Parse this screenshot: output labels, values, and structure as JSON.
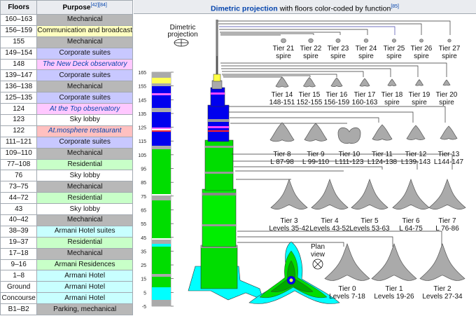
{
  "table": {
    "col_floors": "Floors",
    "col_purpose": "Purpose",
    "col_purpose_ref": "[42][84]",
    "rows": [
      {
        "floors": "160–163",
        "purpose": "Mechanical",
        "color": "#b8b8b8"
      },
      {
        "floors": "156–159",
        "purpose": "Communication and broadcast",
        "color": "#ffffc0"
      },
      {
        "floors": "155",
        "purpose": "Mechanical",
        "color": "#b8b8b8"
      },
      {
        "floors": "149–154",
        "purpose": "Corporate suites",
        "color": "#c8c8ff"
      },
      {
        "floors": "148",
        "purpose": "The New Deck observatory",
        "color": "#ffc8ff",
        "italic": true
      },
      {
        "floors": "139–147",
        "purpose": "Corporate suites",
        "color": "#c8c8ff"
      },
      {
        "floors": "136–138",
        "purpose": "Mechanical",
        "color": "#b8b8b8"
      },
      {
        "floors": "125–135",
        "purpose": "Corporate suites",
        "color": "#c8c8ff"
      },
      {
        "floors": "124",
        "purpose": "At the Top observatory",
        "color": "#ffc8ff",
        "italic": true
      },
      {
        "floors": "123",
        "purpose": "Sky lobby",
        "color": "#ffffff"
      },
      {
        "floors": "122",
        "purpose": "At.mosphere restaurant",
        "color": "#ffc0c0",
        "italic": true
      },
      {
        "floors": "111–121",
        "purpose": "Corporate suites",
        "color": "#c8c8ff"
      },
      {
        "floors": "109–110",
        "purpose": "Mechanical",
        "color": "#b8b8b8"
      },
      {
        "floors": "77–108",
        "purpose": "Residential",
        "color": "#c8ffc8"
      },
      {
        "floors": "76",
        "purpose": "Sky lobby",
        "color": "#ffffff"
      },
      {
        "floors": "73–75",
        "purpose": "Mechanical",
        "color": "#b8b8b8"
      },
      {
        "floors": "44–72",
        "purpose": "Residential",
        "color": "#c8ffc8"
      },
      {
        "floors": "43",
        "purpose": "Sky lobby",
        "color": "#ffffff"
      },
      {
        "floors": "40–42",
        "purpose": "Mechanical",
        "color": "#b8b8b8"
      },
      {
        "floors": "38–39",
        "purpose": "Armani Hotel suites",
        "color": "#c8ffff"
      },
      {
        "floors": "19–37",
        "purpose": "Residential",
        "color": "#c8ffc8"
      },
      {
        "floors": "17–18",
        "purpose": "Mechanical",
        "color": "#b8b8b8"
      },
      {
        "floors": "9–16",
        "purpose": "Armani Residences",
        "color": "#c8ffc8"
      },
      {
        "floors": "1–8",
        "purpose": "Armani Hotel",
        "color": "#c8ffff"
      },
      {
        "floors": "Ground",
        "purpose": "Armani Hotel",
        "color": "#c8ffff"
      },
      {
        "floors": "Concourse",
        "purpose": "Armani Hotel",
        "color": "#c8ffff"
      },
      {
        "floors": "B1–B2",
        "purpose": "Parking, mechanical",
        "color": "#b8b8b8"
      }
    ]
  },
  "header": {
    "title": "Dimetric projection",
    "rest": " with floors color-coded by function",
    "ref": "[85]"
  },
  "diagram": {
    "projection_label_1": "Dimetric",
    "projection_label_2": "projection",
    "plan_label_1": "Plan",
    "plan_label_2": "view",
    "scale_ticks": [
      "165",
      "155",
      "145",
      "135",
      "125",
      "115",
      "105",
      "95",
      "85",
      "75",
      "65",
      "55",
      "45",
      "35",
      "25",
      "15",
      "5",
      "-5"
    ],
    "spire_tiers": [
      "Tier 21",
      "Tier 22",
      "Tier 23",
      "Tier 24",
      "Tier 25",
      "Tier 26",
      "Tier 27"
    ],
    "spire_word": "spire",
    "row2": [
      {
        "tier": "Tier 14",
        "levels": "148-151"
      },
      {
        "tier": "Tier 15",
        "levels": "152-155"
      },
      {
        "tier": "Tier 16",
        "levels": "156-159"
      },
      {
        "tier": "Tier 17",
        "levels": "160-163"
      },
      {
        "tier": "Tier 18",
        "levels": "spire"
      },
      {
        "tier": "Tier 19",
        "levels": "spire"
      },
      {
        "tier": "Tier 20",
        "levels": "spire"
      }
    ],
    "row3": [
      {
        "tier": "Tier 8",
        "levels": "L 87-98"
      },
      {
        "tier": "Tier 9",
        "levels": "L 99-110"
      },
      {
        "tier": "Tier 10",
        "levels": "L111-123"
      },
      {
        "tier": "Tier 11",
        "levels": "L124-138"
      },
      {
        "tier": "Tier 12",
        "levels": "L139-143"
      },
      {
        "tier": "Tier 13",
        "levels": "L144-147"
      }
    ],
    "row4": [
      {
        "tier": "Tier 3",
        "levels": "Levels 35-42"
      },
      {
        "tier": "Tier 4",
        "levels": "Levels 43-52"
      },
      {
        "tier": "Tier 5",
        "levels": "Levels 53-63"
      },
      {
        "tier": "Tier 6",
        "levels": "L 64-75"
      },
      {
        "tier": "Tier 7",
        "levels": "L 76-86"
      }
    ],
    "row5": [
      {
        "tier": "Tier 0",
        "levels": "Levels 7-18"
      },
      {
        "tier": "Tier 1",
        "levels": "Levels 19-26"
      },
      {
        "tier": "Tier 2",
        "levels": "Levels 27-34"
      }
    ]
  }
}
